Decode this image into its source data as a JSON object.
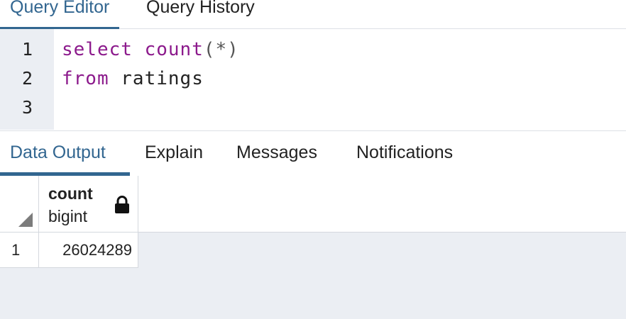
{
  "top_tabs": {
    "query_editor": "Query Editor",
    "query_history": "Query History"
  },
  "editor": {
    "line_numbers": [
      "1",
      "2",
      "3"
    ],
    "line1": {
      "keyword1": "select",
      "keyword2": "count",
      "punct": "(*)"
    },
    "line2": {
      "keyword": "from",
      "text": "ratings"
    }
  },
  "output_tabs": {
    "data_output": "Data Output",
    "explain": "Explain",
    "messages": "Messages",
    "notifications": "Notifications"
  },
  "grid": {
    "columns": [
      {
        "name": "count",
        "type": "bigint",
        "icon": "lock-icon"
      }
    ],
    "rows": [
      {
        "num": "1",
        "values": [
          "26024289"
        ]
      }
    ]
  },
  "colors": {
    "accent": "#326690",
    "keyword": "#8c1a8c",
    "gutter": "#ebeef3"
  }
}
